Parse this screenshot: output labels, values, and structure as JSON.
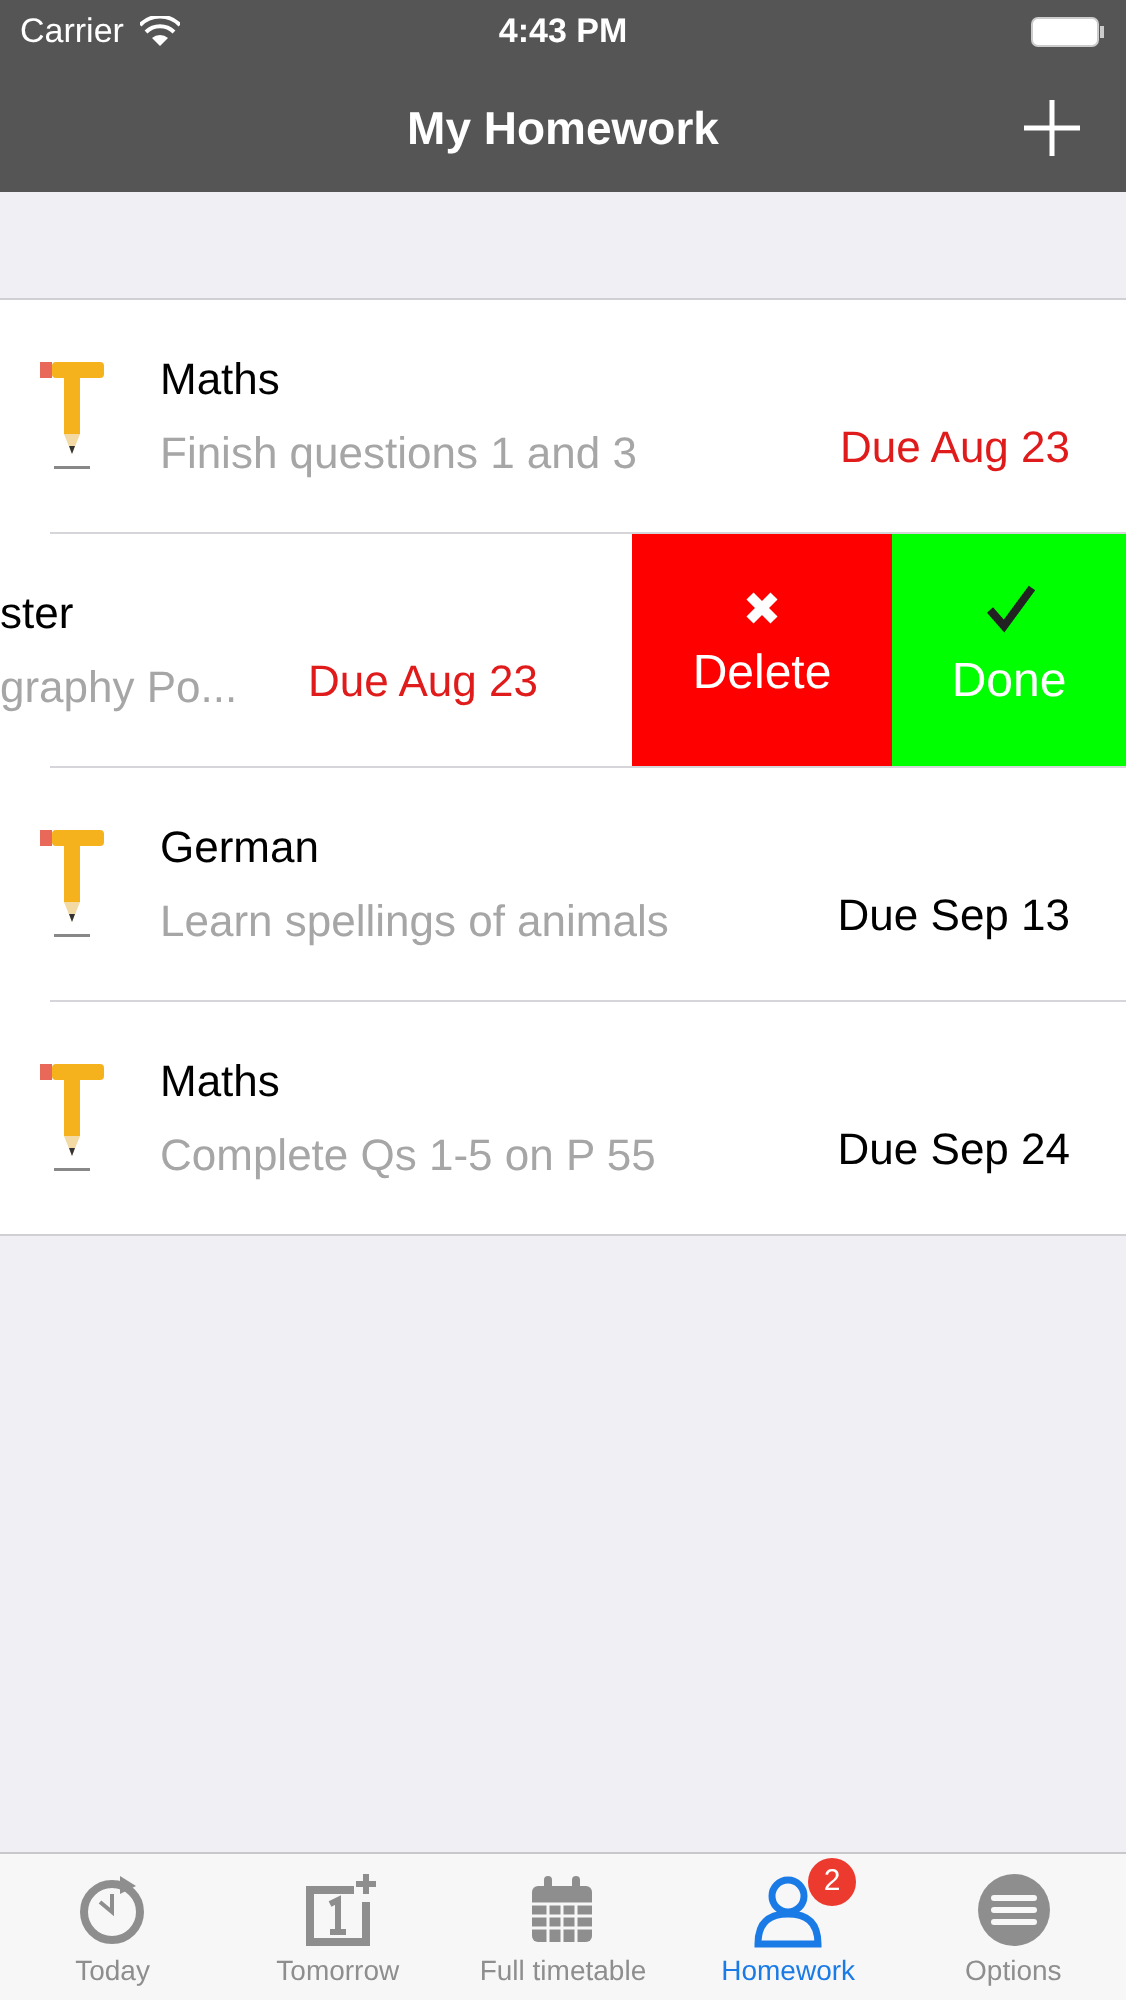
{
  "status_bar": {
    "carrier": "Carrier",
    "time": "4:43 PM"
  },
  "nav": {
    "title": "My Homework"
  },
  "rows": [
    {
      "kind": "normal",
      "title": "Maths",
      "subtitle": "Finish questions 1 and 3",
      "due": "Due Aug 23",
      "overdue": true
    },
    {
      "kind": "swiped",
      "title": "ster",
      "subtitle": "graphy Po...",
      "due": "Due Aug 23",
      "overdue": true,
      "actions": [
        {
          "kind": "delete",
          "label": "Delete"
        },
        {
          "kind": "done",
          "label": "Done"
        }
      ]
    },
    {
      "kind": "normal",
      "title": "German",
      "subtitle": "Learn spellings of animals",
      "due": "Due Sep 13",
      "overdue": false
    },
    {
      "kind": "normal",
      "title": "Maths",
      "subtitle": "Complete Qs 1-5 on P 55",
      "due": "Due Sep 24",
      "overdue": false
    }
  ],
  "tabs": [
    {
      "kind": "today",
      "label": "Today",
      "selected": false
    },
    {
      "kind": "tomorrow",
      "label": "Tomorrow",
      "selected": false
    },
    {
      "kind": "timetable",
      "label": "Full timetable",
      "selected": false
    },
    {
      "kind": "homework",
      "label": "Homework",
      "selected": true,
      "badge": "2"
    },
    {
      "kind": "options",
      "label": "Options",
      "selected": false
    }
  ]
}
